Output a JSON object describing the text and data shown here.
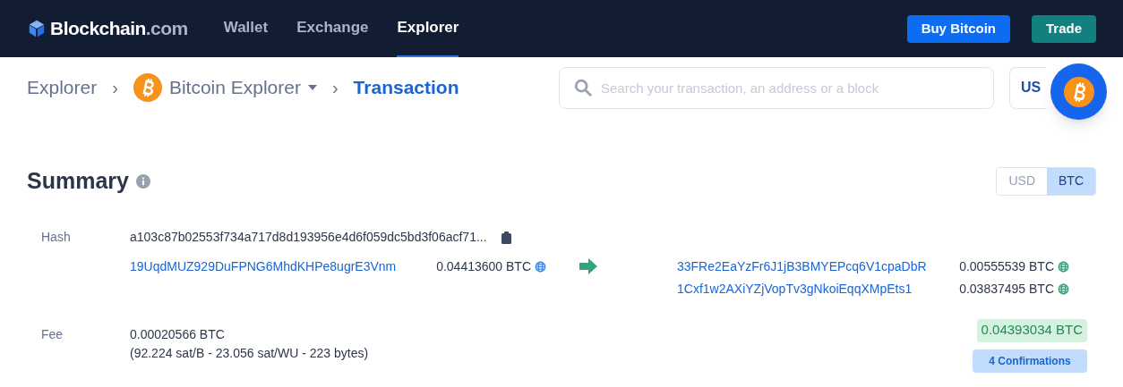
{
  "nav": {
    "logo": {
      "brand": "Blockchain",
      "suffix": ".com"
    },
    "links": [
      {
        "label": "Wallet",
        "selected": false
      },
      {
        "label": "Exchange",
        "selected": false
      },
      {
        "label": "Explorer",
        "selected": true
      }
    ],
    "buttons": [
      {
        "label": "Buy Bitcoin",
        "kind": "primary"
      },
      {
        "label": "Trade",
        "kind": "secondary"
      }
    ]
  },
  "breadcrumb": {
    "root": "Explorer",
    "separator": "›",
    "explorer": "Bitcoin Explorer",
    "current": "Transaction"
  },
  "search": {
    "placeholder": "Search your transaction, an address or a block"
  },
  "currency_button": {
    "label": "US"
  },
  "summary": {
    "title": "Summary",
    "currency_toggle": [
      {
        "label": "USD",
        "selected": false
      },
      {
        "label": "BTC",
        "selected": true
      }
    ],
    "hash": {
      "label": "Hash",
      "value": "a103c87b02553f734a717d8d193956e4d6f059dc5bd3f06acf71..."
    },
    "inputs": [
      {
        "address": "19UqdMUZ929DuFPNG6MhdKHPe8ugrE3Vnm",
        "amount": "0.04413600 BTC"
      }
    ],
    "outputs": [
      {
        "address": "33FRe2EaYzFr6J1jB3BMYEPcq6V1cpaDbR",
        "amount": "0.00555539 BTC"
      },
      {
        "address": "1Cxf1w2AXiYZjVopTv3gNkoiEqqXMpEts1",
        "amount": "0.03837495 BTC"
      }
    ],
    "fee": {
      "label": "Fee",
      "amount": "0.00020566 BTC",
      "details": "(92.224 sat/B - 23.056 sat/WU - 223 bytes)"
    },
    "total": "0.04393034 BTC",
    "confirmations": "4 Confirmations"
  }
}
